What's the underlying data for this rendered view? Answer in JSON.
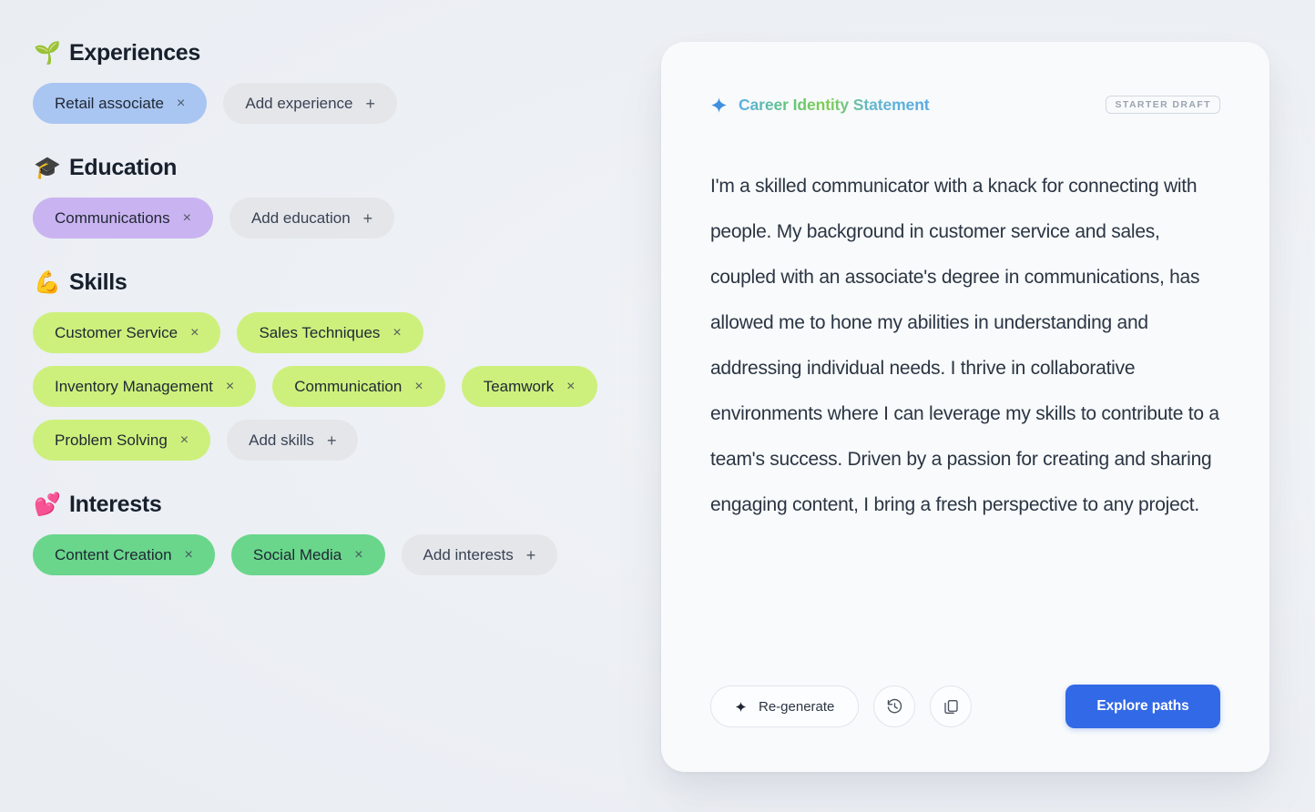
{
  "colors": {
    "page_background": "#eceff4",
    "card_background": "#f8fafb",
    "chip_experience": "#a9c5f2",
    "chip_education": "#c9b3f0",
    "chip_skill": "#cdf07c",
    "chip_interest": "#69d68b",
    "chip_add": "#e4e6ea",
    "primary_button": "#3269e6",
    "badge_text": "#9aa4b2"
  },
  "profile": {
    "sections": [
      {
        "id": "experiences",
        "emoji": "🌱",
        "emoji_name": "seedling-emoji",
        "title": "Experiences",
        "chip_style": "exp",
        "chips": [
          {
            "label": "Retail associate",
            "remove": "×"
          }
        ],
        "add": {
          "label": "Add experience",
          "plus": "+"
        }
      },
      {
        "id": "education",
        "emoji": "🎓",
        "emoji_name": "graduation-cap-emoji",
        "title": "Education",
        "chip_style": "edu",
        "chips": [
          {
            "label": "Communications",
            "remove": "×"
          }
        ],
        "add": {
          "label": "Add education",
          "plus": "+"
        }
      },
      {
        "id": "skills",
        "emoji": "💪",
        "emoji_name": "flexed-biceps-emoji",
        "title": "Skills",
        "chip_style": "skill",
        "chips": [
          {
            "label": "Customer Service",
            "remove": "×"
          },
          {
            "label": "Sales Techniques",
            "remove": "×"
          },
          {
            "label": "Inventory Management",
            "remove": "×"
          },
          {
            "label": "Communication",
            "remove": "×"
          },
          {
            "label": "Teamwork",
            "remove": "×"
          },
          {
            "label": "Problem Solving",
            "remove": "×"
          }
        ],
        "add": {
          "label": "Add skills",
          "plus": "+"
        }
      },
      {
        "id": "interests",
        "emoji": "💕",
        "emoji_name": "two-hearts-emoji",
        "title": "Interests",
        "chip_style": "interest",
        "chips": [
          {
            "label": "Content Creation",
            "remove": "×"
          },
          {
            "label": "Social Media",
            "remove": "×"
          }
        ],
        "add": {
          "label": "Add interests",
          "plus": "+"
        }
      }
    ]
  },
  "card": {
    "icon_name": "sparkle-icon",
    "title": "Career Identity Statement",
    "badge": "STARTER DRAFT",
    "statement": "I'm a skilled communicator with a knack for connecting with people. My background in customer service and sales, coupled with an associate's degree in communications, has allowed me to hone my abilities in understanding and addressing individual needs. I thrive in collaborative environments where I can leverage my skills to contribute to a team's success. Driven by a passion for creating and sharing engaging content, I bring a fresh perspective to any project.",
    "actions": {
      "regenerate_label": "Re-generate",
      "history_icon": "history-icon",
      "copy_icon": "copy-icon",
      "primary_label": "Explore paths"
    }
  }
}
